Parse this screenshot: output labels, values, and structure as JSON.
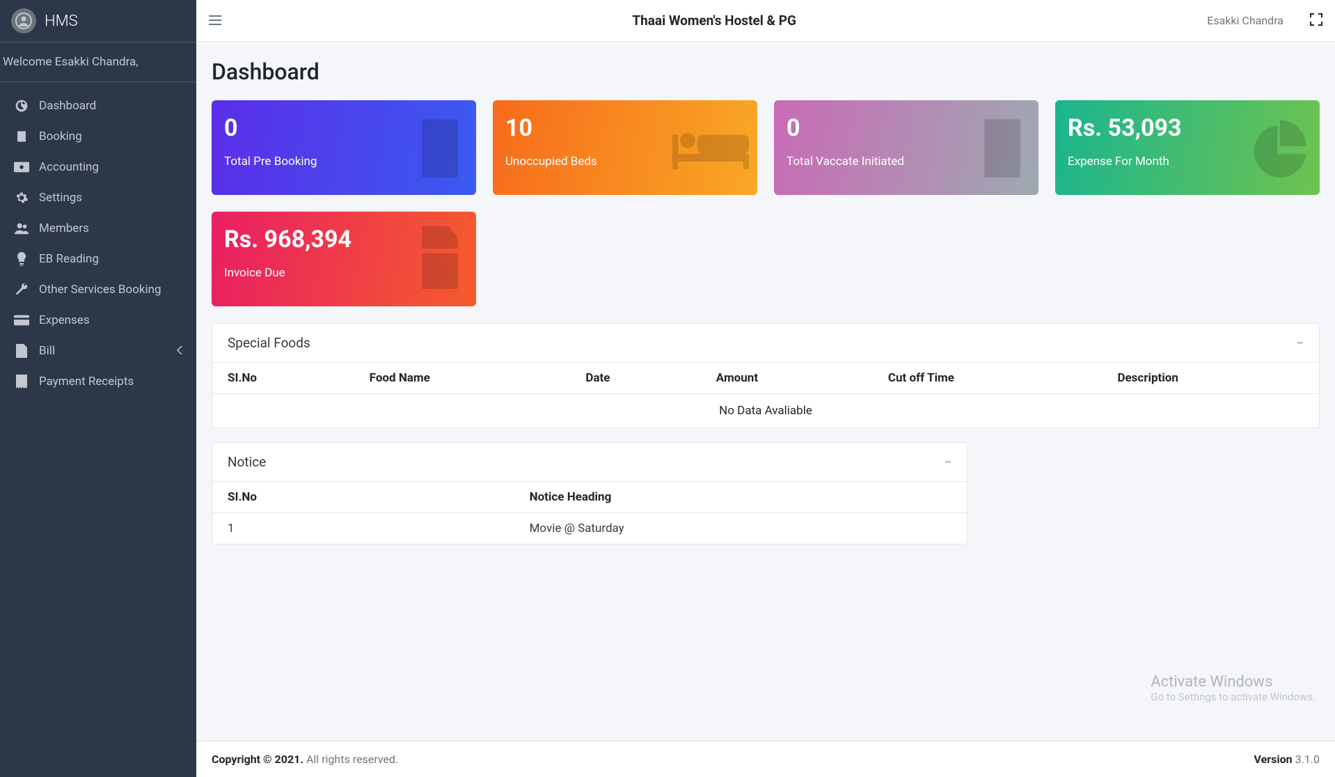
{
  "brand": "HMS",
  "welcome": "Welcome Esakki Chandra,",
  "sidebar": {
    "items": [
      {
        "label": "Dashboard"
      },
      {
        "label": "Booking"
      },
      {
        "label": "Accounting"
      },
      {
        "label": "Settings"
      },
      {
        "label": "Members"
      },
      {
        "label": "EB Reading"
      },
      {
        "label": "Other Services Booking"
      },
      {
        "label": "Expenses"
      },
      {
        "label": "Bill",
        "has_submenu": true
      },
      {
        "label": "Payment Receipts"
      }
    ]
  },
  "topbar": {
    "title": "Thaai Women's Hostel & PG",
    "user": "Esakki Chandra"
  },
  "page_title": "Dashboard",
  "cards": [
    {
      "value": "0",
      "label": "Total Pre Booking"
    },
    {
      "value": "10",
      "label": "Unoccupied Beds"
    },
    {
      "value": "0",
      "label": "Total Vaccate Initiated"
    },
    {
      "value": "Rs. 53,093",
      "label": "Expense For Month"
    },
    {
      "value": "Rs. 968,394",
      "label": "Invoice Due"
    }
  ],
  "special_foods": {
    "title": "Special Foods",
    "columns": [
      "SI.No",
      "Food Name",
      "Date",
      "Amount",
      "Cut off Time",
      "Description"
    ],
    "empty": "No Data Avaliable"
  },
  "notice": {
    "title": "Notice",
    "columns": [
      "SI.No",
      "Notice Heading"
    ],
    "rows": [
      {
        "sino": "1",
        "heading": "Movie @ Saturday"
      }
    ]
  },
  "footer": {
    "copyright_strong": "Copyright © 2021.",
    "copyright_rest": " All rights reserved.",
    "version_label": "Version",
    "version": " 3.1.0"
  },
  "watermark": {
    "line1": "Activate Windows",
    "line2": "Go to Settings to activate Windows."
  }
}
